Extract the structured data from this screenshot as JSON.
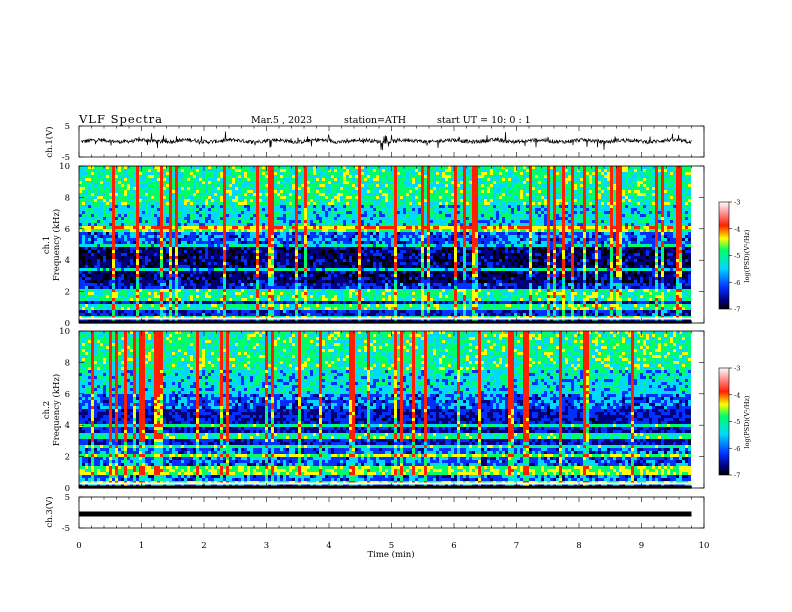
{
  "header": {
    "title": "VLF  Spectra",
    "date": "Mar.5  , 2023",
    "station": "station=ATH",
    "start": "start  UT  =    10: 0   : 1"
  },
  "colors": {
    "dark_blue": "#00007a",
    "blue": "#0030ff",
    "cyan": "#00d8ff",
    "green": "#00ff66",
    "yellow": "#ffff00",
    "red": "#ff2000",
    "white": "#ffffff",
    "black": "#000000"
  },
  "chart_data": [
    {
      "type": "line",
      "name": "ch1-waveform",
      "ylabel": "ch.1(V)",
      "ylim": [
        -5,
        5
      ],
      "yticks": [
        "5",
        "-5"
      ],
      "xlim": [
        0,
        10
      ],
      "data_end_min": 9.8,
      "baseline": 0.2,
      "values_note": ""
    },
    {
      "type": "heatmap",
      "name": "ch1-spectrogram",
      "ylabel": "ch.1\nFrequency  (kHz)",
      "ylim": [
        0,
        10
      ],
      "yticks": [
        "0",
        "2",
        "4",
        "6",
        "8",
        "10"
      ],
      "xlim": [
        0,
        10
      ],
      "data_end_min": 9.8,
      "colorbar": {
        "label": "log(PSD)(V²/Hz)",
        "range": [
          -7,
          -3
        ],
        "ticks": [
          "-3",
          "-4",
          "-5",
          "-6",
          "-7"
        ]
      },
      "bands_khz": [
        0.4,
        1.0,
        1.6,
        1.95,
        2.1,
        3.4,
        4.9,
        6.0
      ]
    },
    {
      "type": "heatmap",
      "name": "ch2-spectrogram",
      "ylabel": "ch.2\nFrequency  (kHz)",
      "ylim": [
        0,
        10
      ],
      "yticks": [
        "0",
        "2",
        "4",
        "6",
        "8",
        "10"
      ],
      "xlim": [
        0,
        10
      ],
      "data_end_min": 9.8,
      "colorbar": {
        "label": "log(PSD)(V²/Hz)",
        "range": [
          -7,
          -3
        ],
        "ticks": [
          "-3",
          "-4",
          "-5",
          "-6",
          "-7"
        ]
      },
      "bands_khz": [
        0.4,
        0.95,
        1.2,
        2.0,
        2.6,
        3.3,
        4.0
      ]
    },
    {
      "type": "line",
      "name": "ch3-waveform",
      "ylabel": "ch.3(V)",
      "ylim": [
        -5,
        5
      ],
      "yticks": [
        "5",
        "-5"
      ],
      "xlim": [
        0,
        10
      ],
      "data_end_min": 9.8,
      "baseline": -0.5
    }
  ],
  "xaxis": {
    "label": "Time  (min)",
    "ticks": [
      "0",
      "1",
      "2",
      "3",
      "4",
      "5",
      "6",
      "7",
      "8",
      "9",
      "10"
    ],
    "range": [
      0,
      10
    ]
  }
}
